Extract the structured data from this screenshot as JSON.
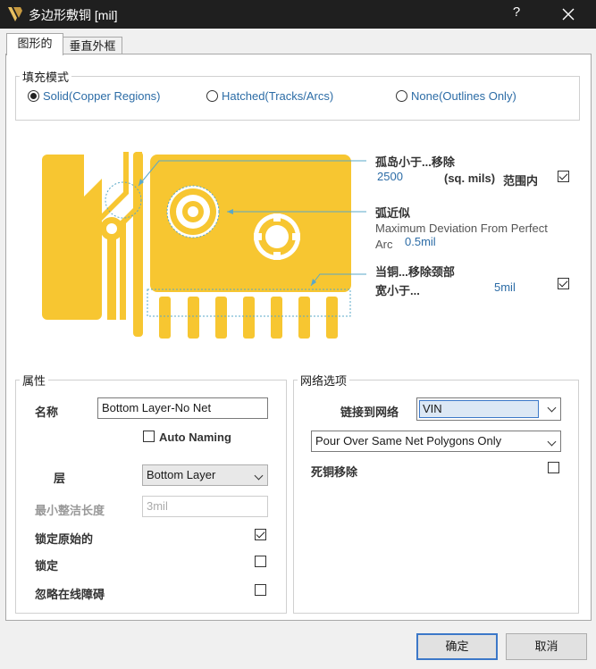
{
  "window": {
    "title": "多边形敷铜 [mil]",
    "help_label": "?"
  },
  "tabs": [
    {
      "label": "图形的",
      "active": true
    },
    {
      "label": "垂直外框",
      "active": false
    }
  ],
  "fill_mode": {
    "title": "填充模式",
    "options": [
      {
        "label": "Solid(Copper Regions)",
        "selected": true
      },
      {
        "label": "Hatched(Tracks/Arcs)",
        "selected": false
      },
      {
        "label": "None(Outlines Only)",
        "selected": false
      }
    ]
  },
  "diagram": {
    "island": {
      "label": "孤岛小于...移除",
      "value": "2500",
      "unit": "(sq. mils)",
      "range_label": "范围内",
      "checked": true
    },
    "arc": {
      "label": "弧近似",
      "description": "Maximum Deviation From Perfect Arc",
      "value": "0.5mil"
    },
    "neck": {
      "label_line1": "当铜...移除颈部",
      "label_line2": "宽小于...",
      "value": "5mil",
      "checked": true
    }
  },
  "properties": {
    "title": "属性",
    "name_label": "名称",
    "name_value": "Bottom Layer-No Net",
    "auto_naming_label": "Auto Naming",
    "auto_naming_checked": false,
    "layer_label": "层",
    "layer_value": "Bottom Layer",
    "min_length_label": "最小整洁长度",
    "min_length_placeholder": "3mil",
    "lock_primitives_label": "锁定原始的",
    "lock_primitives_checked": true,
    "locked_label": "锁定",
    "locked_checked": false,
    "ignore_obstacles_label": "忽略在线障碍",
    "ignore_obstacles_checked": false
  },
  "net_options": {
    "title": "网络选项",
    "connect_label": "链接到网络",
    "net_value": "VIN",
    "pour_mode_value": "Pour Over Same Net Polygons Only",
    "remove_dead_copper_label": "死铜移除",
    "remove_dead_copper_checked": false
  },
  "buttons": {
    "ok_label": "确定",
    "cancel_label": "取消"
  },
  "colors": {
    "copper": "#f7c631",
    "accent_blue": "#2c6ca6",
    "callout": "#5aa8c8"
  }
}
